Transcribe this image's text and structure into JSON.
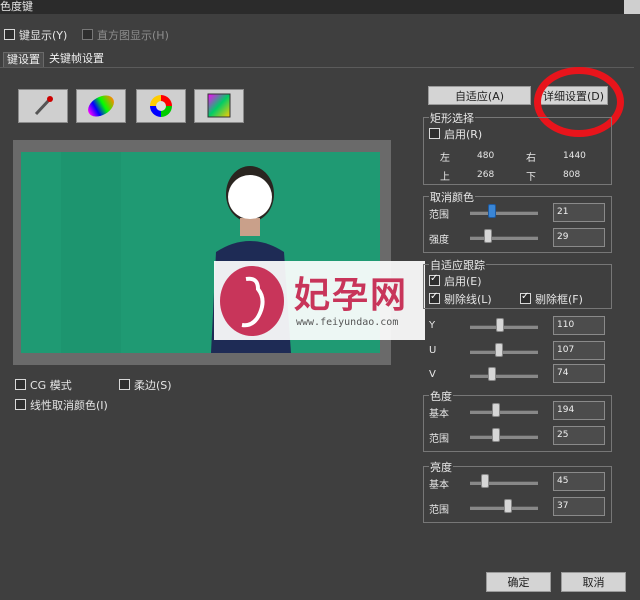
{
  "window": {
    "title": "色度键"
  },
  "top": {
    "key_display": "键显示(Y)",
    "histogram": "直方图显示(H)"
  },
  "tabs": [
    "键设置",
    "关键帧设置"
  ],
  "tools": [
    "eyedropper-icon",
    "color-ellipse-icon",
    "color-wheel-icon",
    "color-square-icon"
  ],
  "buttons": {
    "adaptive": "自适应(A)",
    "detail": "详细设置(D)",
    "ok": "确定",
    "cancel": "取消"
  },
  "rect_select": {
    "title": "矩形选择",
    "enable": "启用(R)",
    "left_label": "左",
    "left": "480",
    "right_label": "右",
    "right": "1440",
    "top_label": "上",
    "top": "268",
    "bottom_label": "下",
    "bottom": "808"
  },
  "cancel_color": {
    "title": "取消颜色",
    "range_label": "范围",
    "range": "21",
    "strength_label": "强度",
    "strength": "29"
  },
  "adaptive_track": {
    "title": "自适应跟踪",
    "enable": "启用(E)",
    "remove_line": "剔除线(L)",
    "remove_frame": "剔除框(F)",
    "y_label": "Y",
    "y": "110",
    "u_label": "U",
    "u": "107",
    "v_label": "V",
    "v": "74"
  },
  "hue": {
    "title": "色度",
    "base_label": "基本",
    "base": "194",
    "range_label": "范围",
    "range": "25"
  },
  "brightness": {
    "title": "亮度",
    "base_label": "基本",
    "base": "45",
    "range_label": "范围",
    "range": "37"
  },
  "options": {
    "cg_mode": "CG 模式",
    "soft_edge": "柔边(S)",
    "linear_cancel": "线性取消颜色(I)"
  },
  "watermark": {
    "brand": "妃孕网",
    "url": "www.feiyundao.com"
  },
  "colors": {
    "background": "#3f3f3f",
    "green_screen": "#1f9a73",
    "highlight": "#e8141b",
    "slider_blue": "#3a86d6"
  }
}
